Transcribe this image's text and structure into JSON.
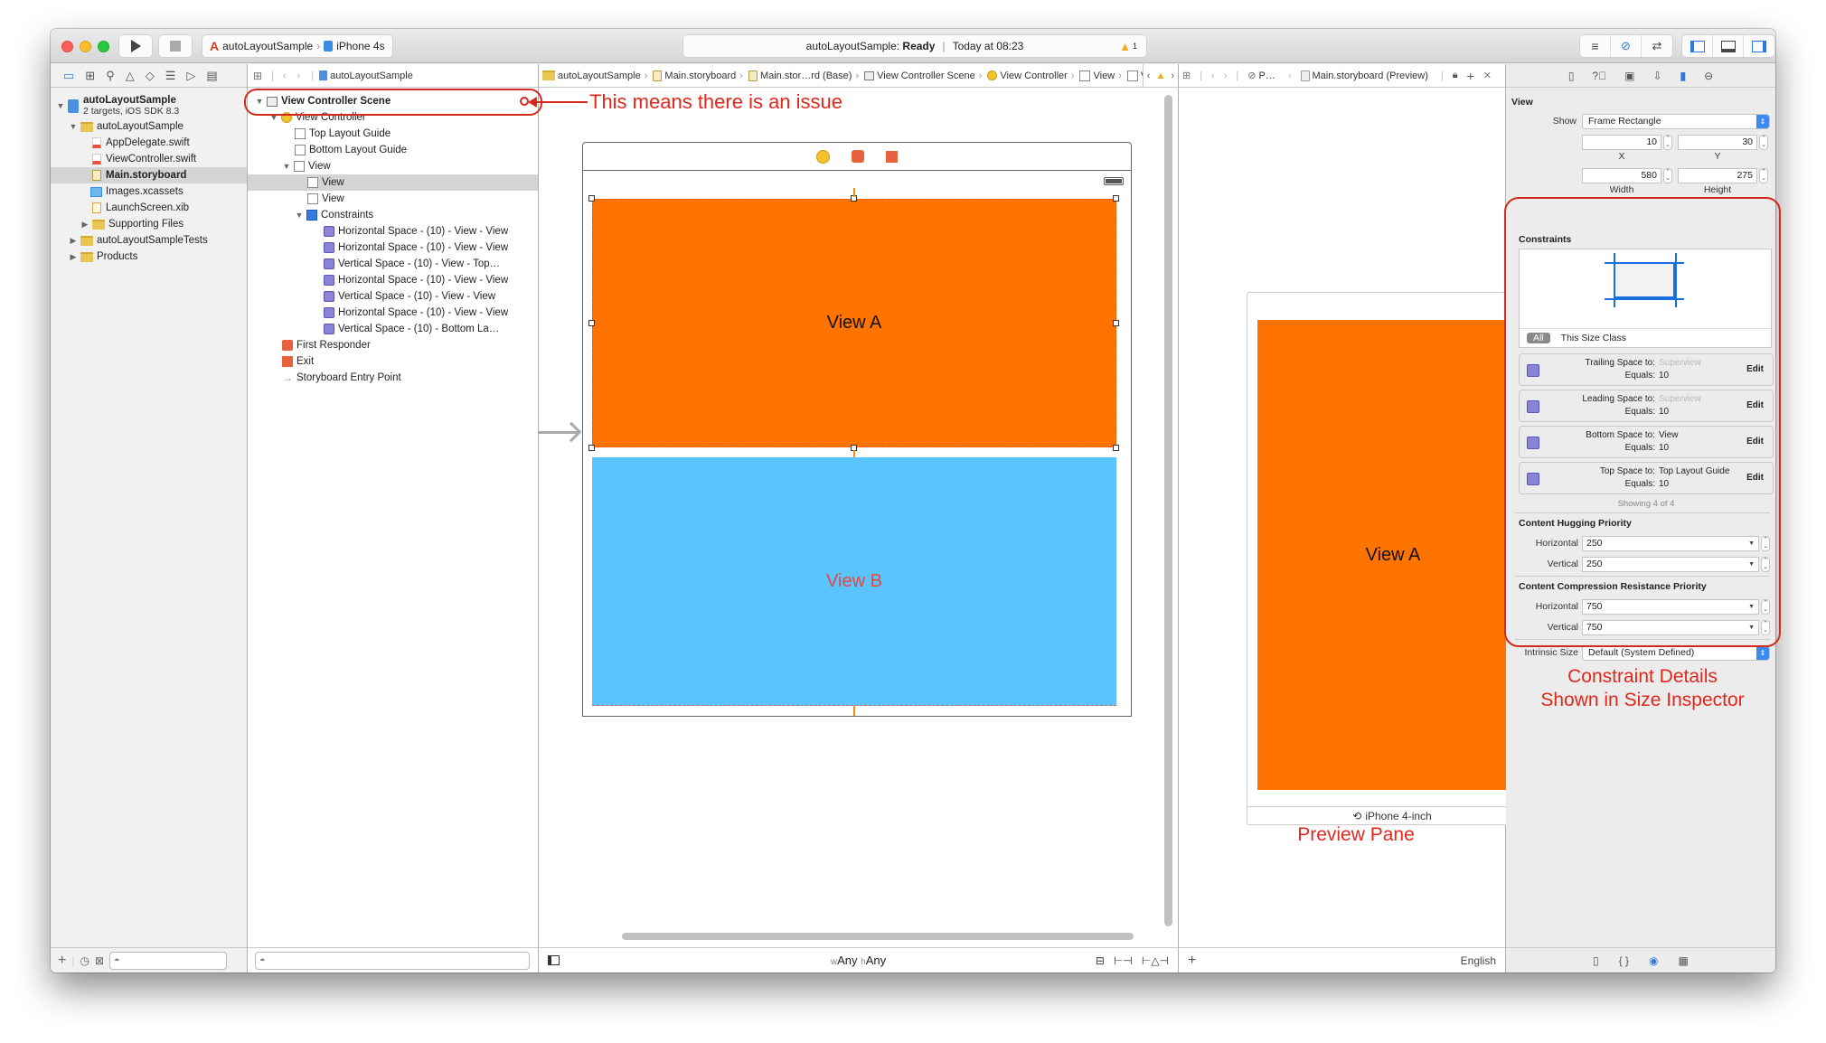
{
  "toolbar": {
    "scheme": "autoLayoutSample",
    "device": "iPhone 4s",
    "activity_project": "autoLayoutSample:",
    "activity_status": "Ready",
    "activity_time": "Today at 08:23",
    "warning_count": "1",
    "icons": [
      "standard-editor-icon",
      "assistant-editor-icon",
      "version-editor-icon",
      "navigator-toggle-icon",
      "debug-area-toggle-icon",
      "utilities-toggle-icon"
    ]
  },
  "navigator": {
    "tab_icons": [
      "project-navigator-icon",
      "symbol-navigator-icon",
      "find-navigator-icon",
      "issue-navigator-icon",
      "test-navigator-icon",
      "debug-navigator-icon",
      "breakpoint-navigator-icon",
      "report-navigator-icon"
    ],
    "project": {
      "name": "autoLayoutSample",
      "subtitle": "2 targets, iOS SDK 8.3"
    },
    "items": [
      {
        "label": "autoLayoutSample",
        "type": "folder",
        "level": 1,
        "expanded": true
      },
      {
        "label": "AppDelegate.swift",
        "type": "swift",
        "level": 2
      },
      {
        "label": "ViewController.swift",
        "type": "swift",
        "level": 2
      },
      {
        "label": "Main.storyboard",
        "type": "storyboard",
        "level": 2,
        "selected": true
      },
      {
        "label": "Images.xcassets",
        "type": "assets",
        "level": 2
      },
      {
        "label": "LaunchScreen.xib",
        "type": "xib",
        "level": 2
      },
      {
        "label": "Supporting Files",
        "type": "folder",
        "level": 2,
        "expanded": false
      },
      {
        "label": "autoLayoutSampleTests",
        "type": "folder",
        "level": 1,
        "expanded": false
      },
      {
        "label": "Products",
        "type": "folder",
        "level": 1,
        "expanded": false
      }
    ]
  },
  "jumpbar": {
    "crumbs": [
      "autoLayoutSample",
      "autoLayoutSample",
      "Main.storyboard",
      "Main.stor…rd (Base)",
      "View Controller Scene",
      "View Controller",
      "View",
      "View"
    ]
  },
  "preview_jumpbar": {
    "crumbs": [
      "P…",
      "Main.storyboard (Preview)"
    ]
  },
  "outline": {
    "scene": "View Controller Scene",
    "items": [
      {
        "label": "View Controller",
        "level": 1,
        "icon": "view-controller-icon"
      },
      {
        "label": "Top Layout Guide",
        "level": 2,
        "icon": "layout-guide-icon"
      },
      {
        "label": "Bottom Layout Guide",
        "level": 2,
        "icon": "layout-guide-icon"
      },
      {
        "label": "View",
        "level": 2,
        "icon": "view-icon"
      },
      {
        "label": "View",
        "level": 3,
        "icon": "view-icon",
        "selected": true
      },
      {
        "label": "View",
        "level": 3,
        "icon": "view-icon"
      },
      {
        "label": "Constraints",
        "level": 3,
        "icon": "constraints-icon"
      },
      {
        "label": "Horizontal Space - (10) - View - View",
        "level": 4,
        "icon": "constraint-icon"
      },
      {
        "label": "Horizontal Space - (10) - View - View",
        "level": 4,
        "icon": "constraint-icon"
      },
      {
        "label": "Vertical Space - (10) - View - Top…",
        "level": 4,
        "icon": "constraint-icon"
      },
      {
        "label": "Horizontal Space - (10) - View - View",
        "level": 4,
        "icon": "constraint-icon"
      },
      {
        "label": "Vertical Space - (10) - View - View",
        "level": 4,
        "icon": "constraint-icon"
      },
      {
        "label": "Horizontal Space - (10) - View - View",
        "level": 4,
        "icon": "constraint-icon"
      },
      {
        "label": "Vertical Space - (10) - Bottom La…",
        "level": 4,
        "icon": "constraint-icon"
      },
      {
        "label": "First Responder",
        "level": 1,
        "icon": "first-responder-icon"
      },
      {
        "label": "Exit",
        "level": 1,
        "icon": "exit-icon"
      },
      {
        "label": "Storyboard Entry Point",
        "level": 1,
        "icon": "entry-point-icon"
      }
    ]
  },
  "canvas": {
    "view_a_label": "View A",
    "view_b_label": "View B",
    "size_class_w_prefix": "w",
    "size_class_w": "Any",
    "size_class_h_prefix": "h",
    "size_class_h": "Any",
    "colors": {
      "view_a": "#ff7300",
      "view_b": "#5ac4fe",
      "view_b_label": "#e8453c"
    }
  },
  "preview": {
    "view_a_label": "View A",
    "device_label": "iPhone 4-inch",
    "language": "English"
  },
  "inspector": {
    "tab_icons": [
      "file-inspector-icon",
      "quick-help-icon",
      "identity-inspector-icon",
      "attributes-inspector-icon",
      "size-inspector-icon",
      "connections-inspector-icon"
    ],
    "section_title": "View",
    "show_label": "Show",
    "show_value": "Frame Rectangle",
    "x": "10",
    "x_label": "X",
    "y": "30",
    "y_label": "Y",
    "width": "580",
    "width_label": "Width",
    "height": "275",
    "height_label": "Height",
    "constraints_title": "Constraints",
    "filter_all": "All",
    "filter_size_class": "This Size Class",
    "constraints": [
      {
        "label": "Trailing Space to:",
        "target": "Superview",
        "target_dim": true,
        "equals_label": "Equals:",
        "value": "10",
        "edit": "Edit"
      },
      {
        "label": "Leading Space to:",
        "target": "Superview",
        "target_dim": true,
        "equals_label": "Equals:",
        "value": "10",
        "edit": "Edit"
      },
      {
        "label": "Bottom Space to:",
        "target": "View",
        "target_dim": false,
        "equals_label": "Equals:",
        "value": "10",
        "edit": "Edit"
      },
      {
        "label": "Top Space to:",
        "target": "Top Layout Guide",
        "target_dim": false,
        "equals_label": "Equals:",
        "value": "10",
        "edit": "Edit"
      }
    ],
    "showing": "Showing 4 of 4",
    "hugging_title": "Content Hugging Priority",
    "hugging_horizontal_label": "Horizontal",
    "hugging_horizontal": "250",
    "hugging_vertical_label": "Vertical",
    "hugging_vertical": "250",
    "compression_title": "Content Compression Resistance Priority",
    "compression_horizontal_label": "Horizontal",
    "compression_horizontal": "750",
    "compression_vertical_label": "Vertical",
    "compression_vertical": "750",
    "intrinsic_label": "Intrinsic Size",
    "intrinsic_value": "Default (System Defined)"
  },
  "annotations": {
    "issue": "This means there is an issue",
    "preview_pane": "Preview Pane",
    "constraint_details_line1": "Constraint Details",
    "constraint_details_line2": "Shown in Size Inspector",
    "color": "#e0281c"
  }
}
